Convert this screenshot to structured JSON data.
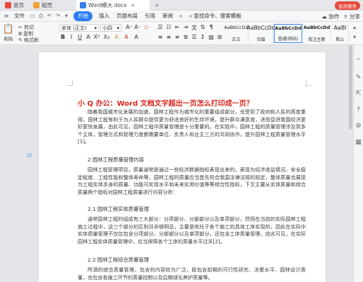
{
  "tabs": {
    "home": "首页",
    "docer": "稻壳",
    "document": "Word模大.docx"
  },
  "title_bar": {
    "upgrade": "会员服务"
  },
  "menu": {
    "file_label": "文件",
    "items": [
      "开始",
      "插入",
      "页面布局",
      "引用",
      "审阅"
    ],
    "search": "查找命令、搜索模板",
    "collab": "协作",
    "share": "分享"
  },
  "ribbon": {
    "cut": "剪切",
    "copy": "复制",
    "format_painter": "格式刷",
    "paste": "粘贴",
    "font_name": "宋体 (正文)",
    "font_size": "小四",
    "styles": [
      {
        "sample": "AaBbCcDd",
        "name": "正文"
      },
      {
        "sample": "AaBbCcDd",
        "name": "页眉"
      },
      {
        "sample": "AaBbCcDd",
        "name": "普通(网站)"
      },
      {
        "sample": "AaBbCcDd",
        "name": "批注主题"
      },
      {
        "sample": "AaBl",
        "name": "默认"
      }
    ]
  },
  "document": {
    "title": "小 Q 办公：Word 文档文字超出一页怎么打印成一页？",
    "p1": "随着我国城市化发展的加速，园林工程作为城市化的重要组成部分，也受到了政府和人民的高度重视。园林工程有利于为人民群众提供更为舒适良好的生存环境，提升群众满意度，进而促进我国经济更好更快发展，由此可见，园林工程中质量管理是十分重要的。在实践中，园林工程的质量管理涉及到多个主体，管理方式和管理力度都需要单位、负责人和业主三方的共同协作，提升园林工程质量管理水平[1]。",
    "h2": "2 园林工程质量管理内容",
    "p2": "园林工程管理项目，质量通常是通过一些经济数据指标表现出来的，表现为经济收益情况、安全稳定程度、工程性能和整体寿命等。园林工程的质量应当首先符合我国法律法规的规定，整体质量也展现为工程实体本身的质量、功能可实现水平和未来实用价值等等综合性指标，下文主要从实体质量和综合质量两个指标对园林工程质量进行内容分析：",
    "h21": "2.1 园林工程实体质量管理",
    "p3": "通常园林工程的组成有三大部分：分项部分、分部部分以及单项部分，然而在当前的实际园林工程施工过程中，这三个部分的区别并非很明显，主要是依托于各个施工的具体工序实现的，因此在实际中实体质量管理不仅仅包含分项部分、分部部分以及单项部分，还包含工序质量管理，由此可见，在实际园林工程实体质量管理中，应当保障各个工序的质量水平过关[2]。",
    "h22": "2.2 园林工程综合质量管理",
    "p4": "所谓的综合质量管理，包含的内容较为广泛，既包含前期的可行性研究、决策水平、园林设计质量，也包含各施工环节的质量控制以及后期绿化养护质量等。"
  }
}
